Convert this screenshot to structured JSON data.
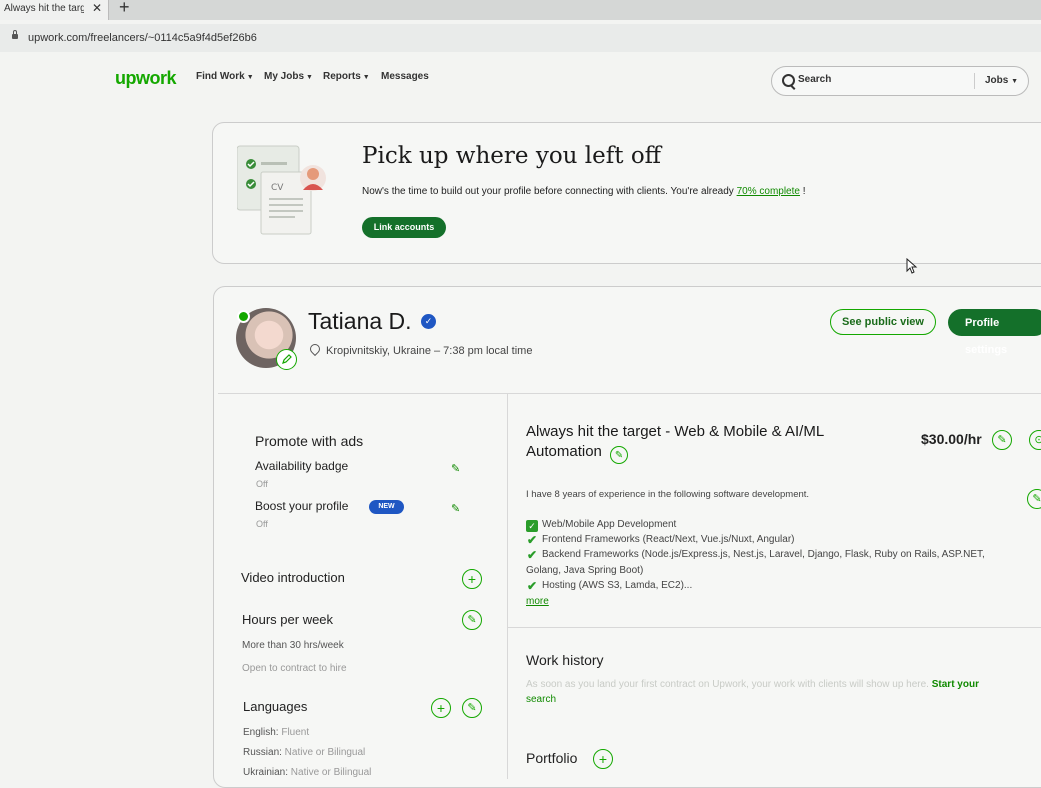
{
  "browser": {
    "tab_title": "Always hit the target",
    "tab_close": "✕",
    "new_tab": "+",
    "url": "upwork.com/freelancers/~0114c5a9f4d5ef26b6"
  },
  "header": {
    "logo": "upwork",
    "nav": [
      "Find Work",
      "My Jobs",
      "Reports",
      "Messages"
    ],
    "search_placeholder": "Search",
    "search_scope": "Jobs"
  },
  "banner": {
    "title": "Pick up where you left off",
    "text": "Now's the time to build out your profile before connecting with clients. You're already ",
    "progress_link": "70% complete",
    "text_end": " !",
    "button": "Link accounts",
    "illustration_label": "CV"
  },
  "profile": {
    "name": "Tatiana D.",
    "location": "Kropivnitskiy, Ukraine – 7:38 pm local time",
    "see_public_view": "See public view",
    "profile_settings": "Profile settings"
  },
  "left": {
    "promote_title": "Promote with ads",
    "availability_badge": "Availability badge",
    "availability_status": "Off",
    "boost_profile": "Boost your profile",
    "boost_badge": "NEW",
    "boost_status": "Off",
    "video_intro": "Video introduction",
    "hours_title": "Hours per week",
    "hours_value": "More than 30 hrs/week",
    "hours_note": "Open to contract to hire",
    "languages_title": "Languages",
    "languages": [
      {
        "name": "English:",
        "level": " Fluent"
      },
      {
        "name": "Russian:",
        "level": " Native or Bilingual"
      },
      {
        "name": "Ukrainian:",
        "level": " Native or Bilingual"
      }
    ]
  },
  "right": {
    "title": "Always hit the target - Web & Mobile & AI/ML Automation",
    "rate": "$30.00/hr",
    "overview": "I have 8 years of experience in the following software development.",
    "skills": [
      "Web/Mobile App Development",
      "Frontend Frameworks (React/Next, Vue.js/Nuxt, Angular)",
      "Backend Frameworks (Node.js/Express.js, Nest.js, Laravel, Django, Flask, Ruby on Rails, ASP.NET,",
      "Golang, Java Spring Boot)",
      "Hosting (AWS S3, Lamda, EC2)..."
    ],
    "more": "more",
    "work_history_title": "Work history",
    "work_history_text": "As soon as you land your first contract on Upwork, your work with clients will show up here.",
    "work_history_link": "Start your",
    "work_history_link2": "search",
    "portfolio_title": "Portfolio"
  }
}
